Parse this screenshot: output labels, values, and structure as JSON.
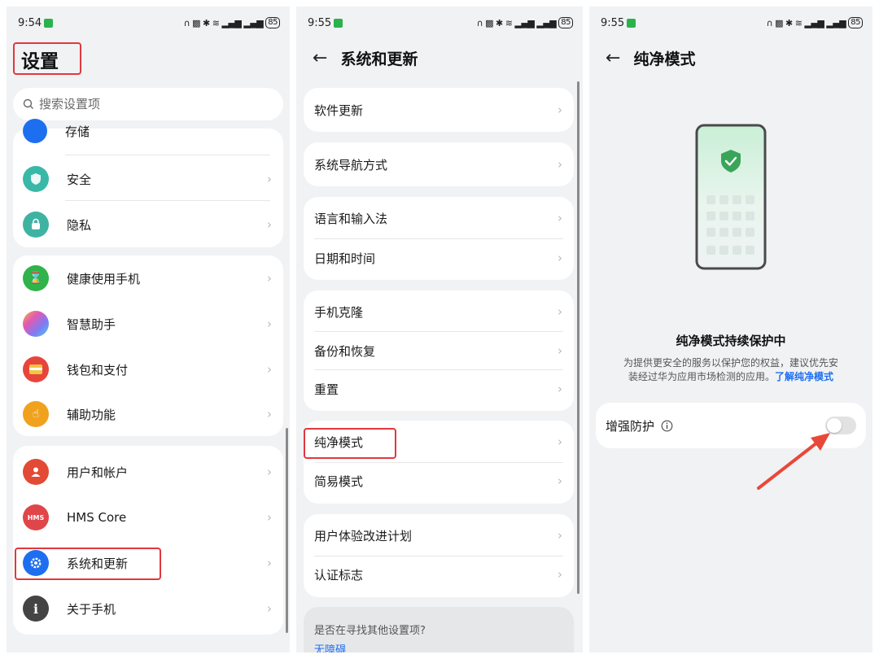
{
  "panel1": {
    "status": {
      "time": "9:54",
      "battery": "85"
    },
    "title": "设置",
    "search": {
      "placeholder": "搜索设置项"
    },
    "partial_item": "存储",
    "groups": [
      {
        "items": [
          {
            "label": "安全",
            "color": "#39b8a8"
          },
          {
            "label": "隐私",
            "color": "#3fb3a2"
          }
        ]
      },
      {
        "items": [
          {
            "label": "健康使用手机",
            "color": "#2fb34a"
          },
          {
            "label": "智慧助手",
            "color": "#a06cf0"
          },
          {
            "label": "钱包和支付",
            "color": "#e7453c"
          },
          {
            "label": "辅助功能",
            "color": "#f0a21f"
          }
        ]
      },
      {
        "items": [
          {
            "label": "用户和帐户",
            "color": "#e24a36"
          },
          {
            "label": "HMS Core",
            "color": "#e0454a",
            "icon_text": "HMS"
          },
          {
            "label": "系统和更新",
            "color": "#1e6ff0"
          },
          {
            "label": "关于手机",
            "color": "#444444",
            "icon_text": "i"
          }
        ]
      }
    ]
  },
  "panel2": {
    "status": {
      "time": "9:55",
      "battery": "85"
    },
    "title": "系统和更新",
    "groups": [
      {
        "items": [
          "软件更新"
        ]
      },
      {
        "items": [
          "系统导航方式"
        ]
      },
      {
        "items": [
          "语言和输入法",
          "日期和时间"
        ]
      },
      {
        "items": [
          "手机克隆",
          "备份和恢复",
          "重置"
        ]
      },
      {
        "items": [
          "纯净模式",
          "简易模式"
        ]
      },
      {
        "items": [
          "用户体验改进计划",
          "认证标志"
        ]
      }
    ],
    "suggest": {
      "question": "是否在寻找其他设置项?",
      "link": "无障碍"
    }
  },
  "panel3": {
    "status": {
      "time": "9:55",
      "battery": "85"
    },
    "title": "纯净模式",
    "status_title": "纯净模式持续保护中",
    "desc_line1": "为提供更安全的服务以保护您的权益，建议优先安",
    "desc_line2": "装经过华为应用市场检测的应用。",
    "desc_link": "了解纯净模式",
    "enhance": {
      "label": "增强防护",
      "enabled": false
    }
  },
  "colors": {
    "highlight": "#e0383e",
    "link": "#1e6ff0",
    "shield": "#3aa55a"
  }
}
